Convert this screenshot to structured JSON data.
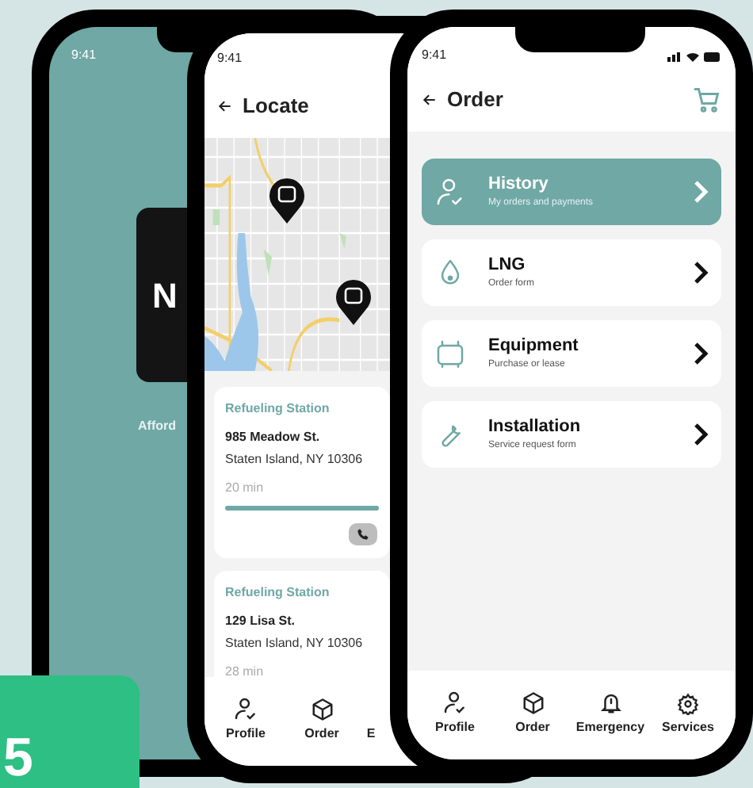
{
  "phones": [
    {
      "kind": "splash",
      "time": "9:41",
      "card_text": "N",
      "tagline": "Afford"
    },
    {
      "kind": "locate",
      "time": "9:41",
      "title": "Locate",
      "stations": [
        {
          "label": "Refueling Station",
          "street": "985 Meadow St.",
          "city": "Staten Island, NY 10306",
          "eta": "20 min",
          "level": 1
        },
        {
          "label": "Refueling Station",
          "street": "129 Lisa St.",
          "city": "Staten Island, NY 10306",
          "eta": "28 min"
        }
      ],
      "nav": [
        {
          "label": "Profile"
        },
        {
          "label": "Order"
        },
        {
          "label": "E"
        }
      ]
    },
    {
      "kind": "order",
      "time": "9:41",
      "title": "Order",
      "items": [
        {
          "title": "History",
          "subtitle": "My orders and payments",
          "selected": true
        },
        {
          "title": "LNG",
          "subtitle": "Order form",
          "selected": false
        },
        {
          "title": "Equipment",
          "subtitle": "Purchase or lease",
          "selected": false
        },
        {
          "title": "Installation",
          "subtitle": "Service request form",
          "selected": false
        }
      ],
      "nav": [
        {
          "label": "Profile"
        },
        {
          "label": "Order"
        },
        {
          "label": "Emergency"
        },
        {
          "label": "Services"
        }
      ]
    }
  ],
  "badge": {
    "text": "5"
  }
}
